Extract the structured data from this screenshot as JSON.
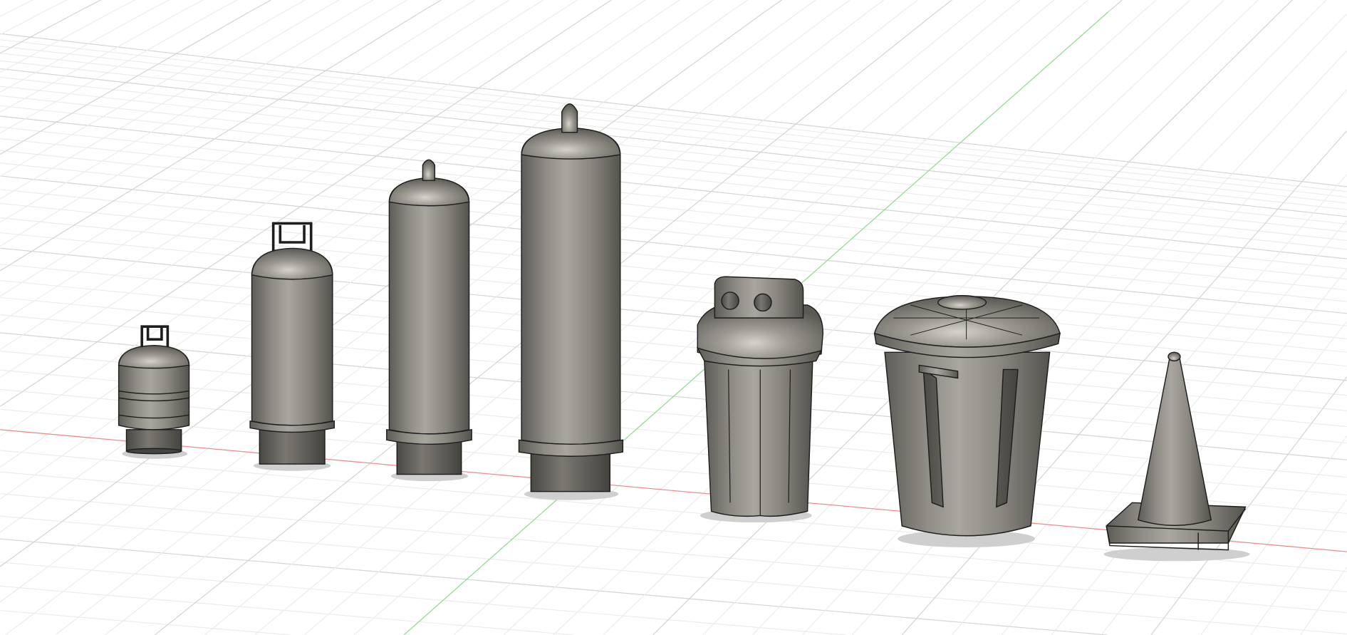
{
  "viewport": {
    "background": "#ffffff",
    "grid_minor_color": "#ececec",
    "grid_major_color": "#d4d4d4",
    "x_axis_color": "#f08a8a",
    "y_axis_color": "#8fe08f",
    "model_color": "#8a8780",
    "edge_color": "#1e1e1e"
  },
  "objects": [
    {
      "id": "propane-tank-small"
    },
    {
      "id": "propane-tank-medium"
    },
    {
      "id": "gas-cylinder-tall"
    },
    {
      "id": "gas-cylinder-extra-tall"
    },
    {
      "id": "trash-bin-square"
    },
    {
      "id": "trash-can-round"
    },
    {
      "id": "traffic-cone"
    }
  ]
}
